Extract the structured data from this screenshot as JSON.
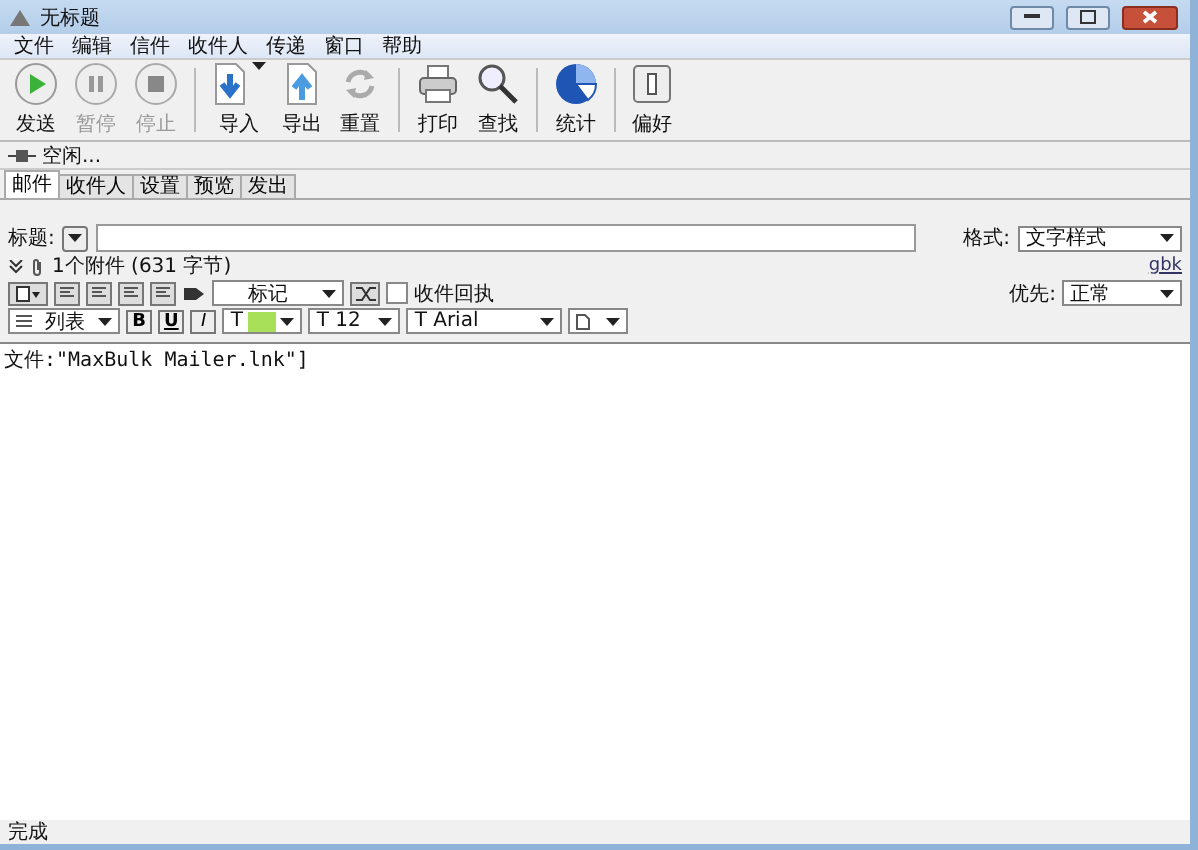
{
  "window": {
    "title": "无标题"
  },
  "menu": [
    "文件",
    "编辑",
    "信件",
    "收件人",
    "传递",
    "窗口",
    "帮助"
  ],
  "toolbar_groups": [
    [
      {
        "label": "发送",
        "kind": "play",
        "disabled": false,
        "dropdown": false
      },
      {
        "label": "暂停",
        "kind": "pause",
        "disabled": true,
        "dropdown": false
      },
      {
        "label": "停止",
        "kind": "stop",
        "disabled": true,
        "dropdown": false
      }
    ],
    [
      {
        "label": "导入",
        "kind": "import",
        "disabled": false,
        "dropdown": true
      },
      {
        "label": "导出",
        "kind": "export",
        "disabled": false,
        "dropdown": false
      },
      {
        "label": "重置",
        "kind": "reset",
        "disabled": false,
        "dropdown": false
      }
    ],
    [
      {
        "label": "打印",
        "kind": "print",
        "disabled": false,
        "dropdown": false
      },
      {
        "label": "查找",
        "kind": "find",
        "disabled": false,
        "dropdown": false
      }
    ],
    [
      {
        "label": "统计",
        "kind": "stats",
        "disabled": false,
        "dropdown": false
      }
    ],
    [
      {
        "label": "偏好",
        "kind": "prefs",
        "disabled": false,
        "dropdown": false
      }
    ]
  ],
  "status": "空闲...",
  "tabs": [
    {
      "label": "邮件",
      "selected": true
    },
    {
      "label": "收件人",
      "selected": false
    },
    {
      "label": "设置",
      "selected": false
    },
    {
      "label": "预览",
      "selected": false
    },
    {
      "label": "发出",
      "selected": false
    }
  ],
  "subject": {
    "label": "标题:"
  },
  "format": {
    "label": "格式:",
    "value": "文字样式"
  },
  "charset_link": "gbk",
  "attachments": "1个附件 (631 字节)",
  "priority": {
    "label": "优先:",
    "value": "正常"
  },
  "mark_select": "标记",
  "receipt": {
    "label": "收件回执",
    "checked": false
  },
  "list_select": "列表",
  "style_buttons": [
    "B",
    "U",
    "I"
  ],
  "text_color": {
    "label": "T",
    "color": "#a8e05a"
  },
  "font_size": "T 12",
  "font_name": "T Arial",
  "body": "文件:\"MaxBulk Mailer.lnk\"]",
  "status_bar": "完成"
}
